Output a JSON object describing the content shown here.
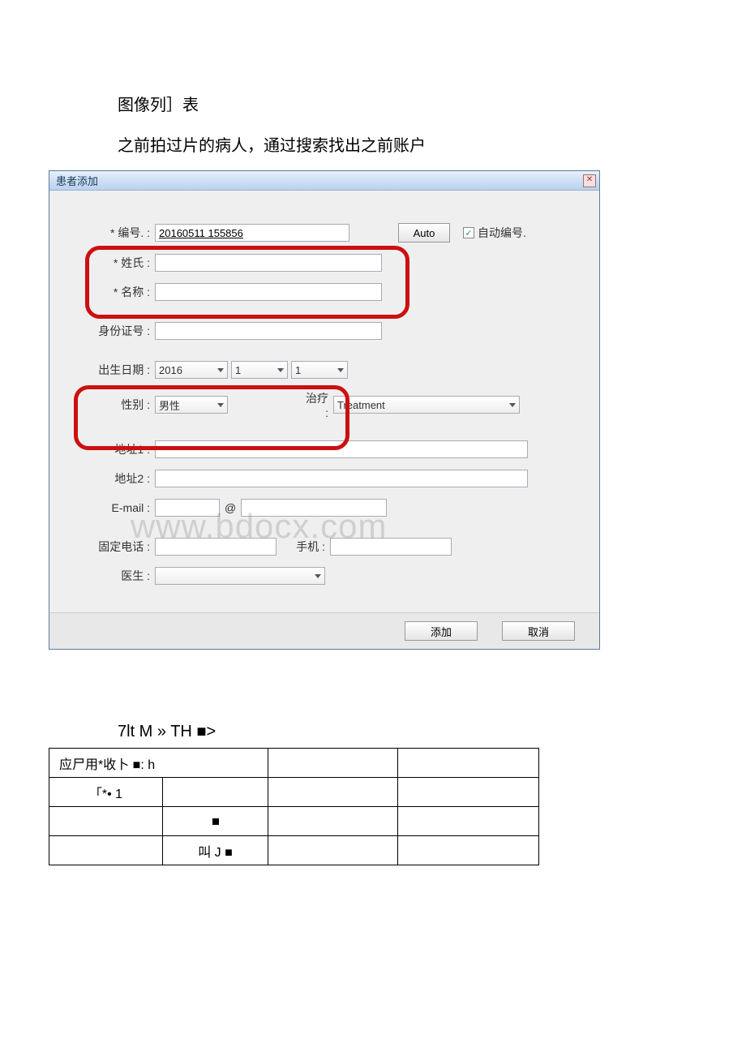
{
  "intro": {
    "line1": "图像列］表",
    "line2": "之前拍过片的病人，通过搜索找出之前账户"
  },
  "dialog": {
    "title": "患者添加",
    "close_symbol": "✕",
    "fields": {
      "id_label": "* 编号. :",
      "id_value": "20160511 155856",
      "auto_btn": "Auto",
      "auto_number_label": "自动编号.",
      "auto_number_checked": "✓",
      "lastname_label": "* 姓氏 :",
      "firstname_label": "* 名称 :",
      "idcard_label": "身份证号 :",
      "birth_label": "出生日期 :",
      "birth_year": "2016",
      "birth_month": "1",
      "birth_day": "1",
      "gender_label": "性别 :",
      "gender_value": "男性",
      "treatment_label": "治疗 :",
      "treatment_value": "Treatment",
      "address1_label": "地址1 :",
      "address2_label": "地址2 :",
      "email_label": "E-mail :",
      "email_at": "@",
      "phone_label": "固定电话 :",
      "mobile_label": "手机 :",
      "doctor_label": "医生 :"
    },
    "footer": {
      "add_btn": "添加",
      "cancel_btn": "取消"
    },
    "watermark": "www.bdocx.com"
  },
  "section2": {
    "title": "7lt M » TH ■>",
    "table": {
      "r1c1": "应尸用*收卜 ■: h",
      "r2c1": "「*• 1",
      "r3c2": "■",
      "r4c2": "叫 J ■"
    }
  }
}
